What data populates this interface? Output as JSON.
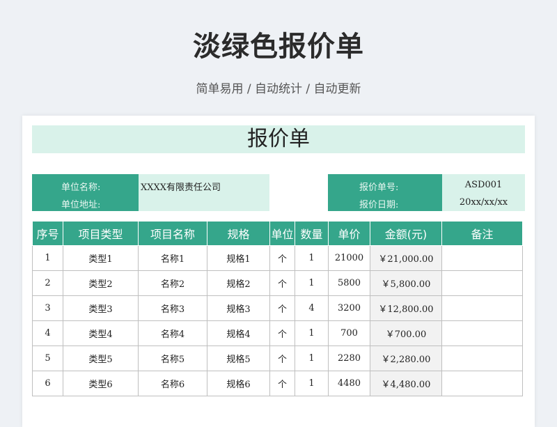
{
  "page": {
    "title": "淡绿色报价单",
    "subtitle": "简单易用 / 自动统计 / 自动更新"
  },
  "sheet": {
    "title": "报价单",
    "info": {
      "company_label": "单位名称:",
      "company_value": "XXXX有限责任公司",
      "address_label": "单位地址:",
      "address_value": "",
      "quote_no_label": "报价单号:",
      "quote_no_value": "ASD001",
      "quote_date_label": "报价日期:",
      "quote_date_value": "20xx/xx/xx"
    },
    "columns": [
      "序号",
      "项目类型",
      "项目名称",
      "规格",
      "单位",
      "数量",
      "单价",
      "金额(元)",
      "备注"
    ],
    "rows": [
      [
        "1",
        "类型1",
        "名称1",
        "规格1",
        "个",
        "1",
        "21000",
        "￥21,000.00",
        ""
      ],
      [
        "2",
        "类型2",
        "名称2",
        "规格2",
        "个",
        "1",
        "5800",
        "￥5,800.00",
        ""
      ],
      [
        "3",
        "类型3",
        "名称3",
        "规格3",
        "个",
        "4",
        "3200",
        "￥12,800.00",
        ""
      ],
      [
        "4",
        "类型4",
        "名称4",
        "规格4",
        "个",
        "1",
        "700",
        "￥700.00",
        ""
      ],
      [
        "5",
        "类型5",
        "名称5",
        "规格5",
        "个",
        "1",
        "2280",
        "￥2,280.00",
        ""
      ],
      [
        "6",
        "类型6",
        "名称6",
        "规格6",
        "个",
        "1",
        "4480",
        "￥4,480.00",
        ""
      ]
    ]
  },
  "colors": {
    "accent": "#35a68b",
    "light_accent": "#d9f2ea",
    "background": "#eef1f5"
  }
}
